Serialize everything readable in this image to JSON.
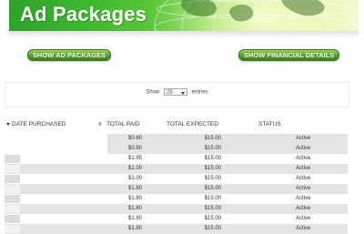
{
  "header": {
    "title": "Ad Packages"
  },
  "toolbar": {
    "show_packages_label": "SHOW AD PACKAGES",
    "show_financial_label": "SHOW FINANCIAL DETAILS"
  },
  "controls": {
    "show_label": "Show",
    "page_size_value": "25",
    "entries_label": "entries"
  },
  "table": {
    "columns": {
      "date": "DATE PURCHASED",
      "hash": "#",
      "paid": "TOTAL PAID",
      "expected": "TOTAL EXPECTED",
      "status": "STATUS"
    },
    "rows": [
      {
        "paid": "$0.80",
        "expected": "$15.00",
        "status": "Active"
      },
      {
        "paid": "$0.80",
        "expected": "$15.00",
        "status": "Active"
      },
      {
        "paid": "$1.95",
        "expected": "$15.00",
        "status": "Active"
      },
      {
        "paid": "$1.00",
        "expected": "$15.00",
        "status": "Active"
      },
      {
        "paid": "$1.00",
        "expected": "$15.00",
        "status": "Active"
      },
      {
        "paid": "$1.80",
        "expected": "$15.00",
        "status": "Active"
      },
      {
        "paid": "$1.80",
        "expected": "$15.00",
        "status": "Active"
      },
      {
        "paid": "$1.80",
        "expected": "$15.00",
        "status": "Active"
      },
      {
        "paid": "$1.80",
        "expected": "$15.00",
        "status": "Active"
      },
      {
        "paid": "$1.80",
        "expected": "$15.00",
        "status": "Active"
      }
    ]
  },
  "colors": {
    "banner_green": "#3cb82e",
    "button_green": "#57a22e",
    "row_stripe": "#e4e4e4"
  }
}
